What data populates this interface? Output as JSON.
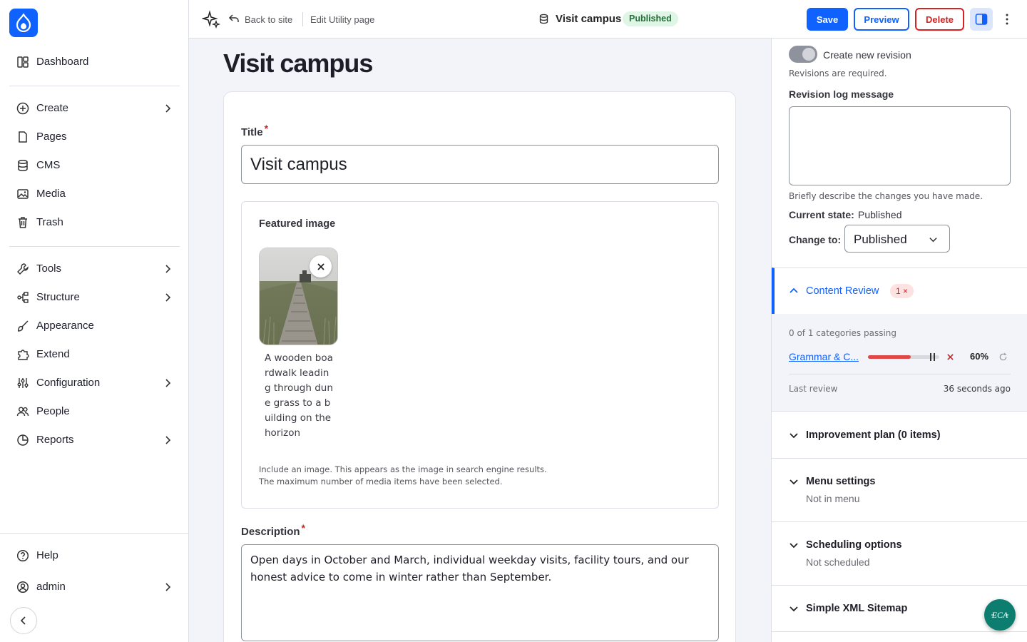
{
  "sidebar": {
    "items": [
      {
        "label": "Dashboard",
        "icon": "dashboard-icon"
      },
      {
        "label": "Create",
        "icon": "plus-circle-icon"
      },
      {
        "label": "Pages",
        "icon": "page-icon"
      },
      {
        "label": "CMS",
        "icon": "database-icon"
      },
      {
        "label": "Media",
        "icon": "media-icon"
      },
      {
        "label": "Trash",
        "icon": "trash-icon"
      },
      {
        "label": "Tools",
        "icon": "wrench-icon"
      },
      {
        "label": "Structure",
        "icon": "structure-icon"
      },
      {
        "label": "Appearance",
        "icon": "brush-icon"
      },
      {
        "label": "Extend",
        "icon": "puzzle-icon"
      },
      {
        "label": "Configuration",
        "icon": "sliders-icon"
      },
      {
        "label": "People",
        "icon": "people-icon"
      },
      {
        "label": "Reports",
        "icon": "pie-chart-icon"
      }
    ],
    "footer": {
      "help": "Help",
      "user": "admin"
    }
  },
  "topbar": {
    "back_label": "Back to site",
    "edit_label": "Edit Utility page",
    "entity_title": "Visit campus",
    "status_badge": "Published",
    "save": "Save",
    "preview": "Preview",
    "delete": "Delete"
  },
  "main": {
    "page_title": "Visit campus",
    "title_label": "Title",
    "title_value": "Visit campus",
    "featured_image_label": "Featured image",
    "image_alt": "A wooden boardwalk leading through dune grass to a building on the horizon",
    "help_1": "Include an image. This appears as the image in search engine results.",
    "help_2": "The maximum number of media items have been selected.",
    "description_label": "Description",
    "description_value": "Open days in October and March, individual weekday visits, facility tours, and our honest advice to come in winter rather than September."
  },
  "panel": {
    "create_revision": "Create new revision",
    "revisions_required": "Revisions are required.",
    "revision_log_label": "Revision log message",
    "revision_log_help": "Briefly describe the changes you have made.",
    "current_state_label": "Current state:",
    "current_state_value": "Published",
    "change_to_label": "Change to:",
    "change_to_value": "Published",
    "content_review": {
      "title": "Content Review",
      "badge": "1 ×",
      "passing": "0 of 1 categories passing",
      "category": "Grammar & C...",
      "score": "60%",
      "score_fraction": 0.6,
      "last_review_label": "Last review",
      "last_review_value": "36 seconds ago"
    },
    "improvement_plan": "Improvement plan (0 items)",
    "menu_settings": "Menu settings",
    "menu_settings_sub": "Not in menu",
    "scheduling": "Scheduling options",
    "scheduling_sub": "Not scheduled",
    "sitemap": "Simple XML Sitemap"
  },
  "colors": {
    "accent": "#0f62fe",
    "danger": "#d72222",
    "published_bg": "#dff5e5",
    "published_fg": "#25703a",
    "eca": "#0d7d70"
  }
}
